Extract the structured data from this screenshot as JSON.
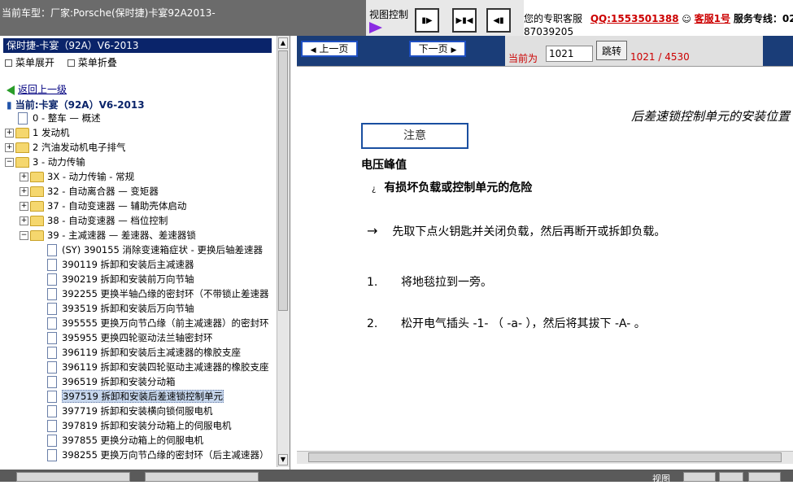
{
  "header": {
    "vehicle_title": "当前车型：厂家:Porsche(保时捷)卡宴92A2013-",
    "view_control_label": "视图控制",
    "contact_prefix": "您的专职客服",
    "qq": "QQ:1553501388",
    "service_name": "客服1号",
    "hotline_label": "服务专线：02",
    "hotline_rest": "87039205"
  },
  "tree": {
    "header": "保时捷-卡宴（92A）V6-2013",
    "expand_all": "菜单展开",
    "collapse_all": "菜单折叠",
    "back": "返回上一级",
    "current": "当前:卡宴（92A）V6-2013",
    "nodes": [
      {
        "label": "0 - 整车 — 概述"
      },
      {
        "label": "1 发动机"
      },
      {
        "label": "2 汽油发动机电子排气"
      },
      {
        "label": "3 - 动力传输"
      },
      {
        "label": "3X - 动力传输 - 常规"
      },
      {
        "label": "32 - 自动离合器 — 变矩器"
      },
      {
        "label": "37 - 自动变速器 — 辅助壳体启动"
      },
      {
        "label": "38 - 自动变速器 — 档位控制"
      },
      {
        "label": "39 - 主减速器 — 差速器、差速器锁"
      },
      {
        "label": "(SY) 390155 消除变速箱症状 - 更换后轴差速器"
      },
      {
        "label": "390119 拆卸和安装后主减速器"
      },
      {
        "label": "390219 拆卸和安装前万向节轴"
      },
      {
        "label": "392255 更换半轴凸缘的密封环（不带锁止差速器"
      },
      {
        "label": "393519 拆卸和安装后万向节轴"
      },
      {
        "label": "395555 更换万向节凸缘（前主减速器）的密封环"
      },
      {
        "label": "395955 更换四轮驱动法兰轴密封环"
      },
      {
        "label": "396119 拆卸和安装后主减速器的橡胶支座"
      },
      {
        "label": "396119 拆卸和安装四轮驱动主减速器的橡胶支座"
      },
      {
        "label": "396519 拆卸和安装分动箱"
      },
      {
        "label": "397519 拆卸和安装后差速锁控制单元"
      },
      {
        "label": "397719 拆卸和安装横向锁伺服电机"
      },
      {
        "label": "397819 拆卸和安装分动箱上的伺服电机"
      },
      {
        "label": "397855 更换分动箱上的伺服电机"
      },
      {
        "label": "398255 更换万向节凸缘的密封环（后主减速器）"
      }
    ]
  },
  "nav": {
    "prev": "上一页",
    "next": "下一页",
    "current_label": "当前为",
    "page_value": "1021",
    "jump": "跳转",
    "page_counter": "1021 / 4530"
  },
  "doc": {
    "title": "后差速锁控制单元的安装位置",
    "notice": "注意",
    "voltage_heading": "电压峰值",
    "danger_mark": "¿",
    "danger": "有损坏负载或控制单元的危险",
    "arrow": "→",
    "arrow_step": "先取下点火钥匙并关闭负载，然后再断开或拆卸负载。",
    "steps": [
      {
        "num": "1.",
        "text": "将地毯拉到一旁。"
      },
      {
        "num": "2.",
        "text": "松开电气插头 -1- （ -a- ），然后将其拔下 -A- 。"
      }
    ]
  },
  "footer": {
    "view_label": "视图"
  }
}
